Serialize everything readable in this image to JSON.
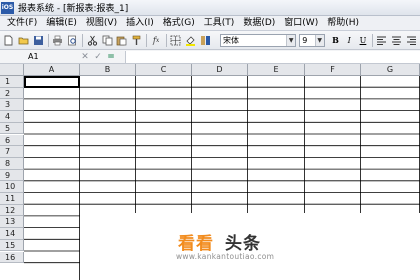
{
  "window": {
    "title": "报表系统 - [新报表:报表_1]",
    "app_icon_text": "iOS"
  },
  "menubar": {
    "items": [
      "文件(F)",
      "编辑(E)",
      "视图(V)",
      "插入(I)",
      "格式(G)",
      "工具(T)",
      "数据(D)",
      "窗口(W)",
      "帮助(H)"
    ]
  },
  "toolbar": {
    "icons": [
      "new-file-icon",
      "open-folder-icon",
      "save-icon",
      "print-icon",
      "print-preview-icon",
      "cut-icon",
      "copy-icon",
      "paste-icon",
      "format-painter-icon",
      "function-icon",
      "border-icon",
      "fill-color-icon",
      "font-color-icon"
    ],
    "font_name": "宋体",
    "font_size": "9",
    "bold_label": "B",
    "italic_label": "I",
    "underline_label": "U"
  },
  "formula_bar": {
    "cell_ref": "A1",
    "cancel_symbol": "✕",
    "confirm_symbol": "✓",
    "equals_symbol": "="
  },
  "sheet": {
    "columns": [
      "A",
      "B",
      "C",
      "D",
      "E",
      "F",
      "G"
    ],
    "rows": [
      "1",
      "2",
      "3",
      "4",
      "5",
      "6",
      "7",
      "8",
      "9",
      "10",
      "11",
      "12",
      "13",
      "14",
      "15",
      "16"
    ],
    "selected_cell": "A1"
  },
  "watermark": {
    "brand_orange": "看看",
    "brand_dark": "头条",
    "url": "www.kankantoutiao.com",
    "accent_color": "#f28c1e"
  }
}
